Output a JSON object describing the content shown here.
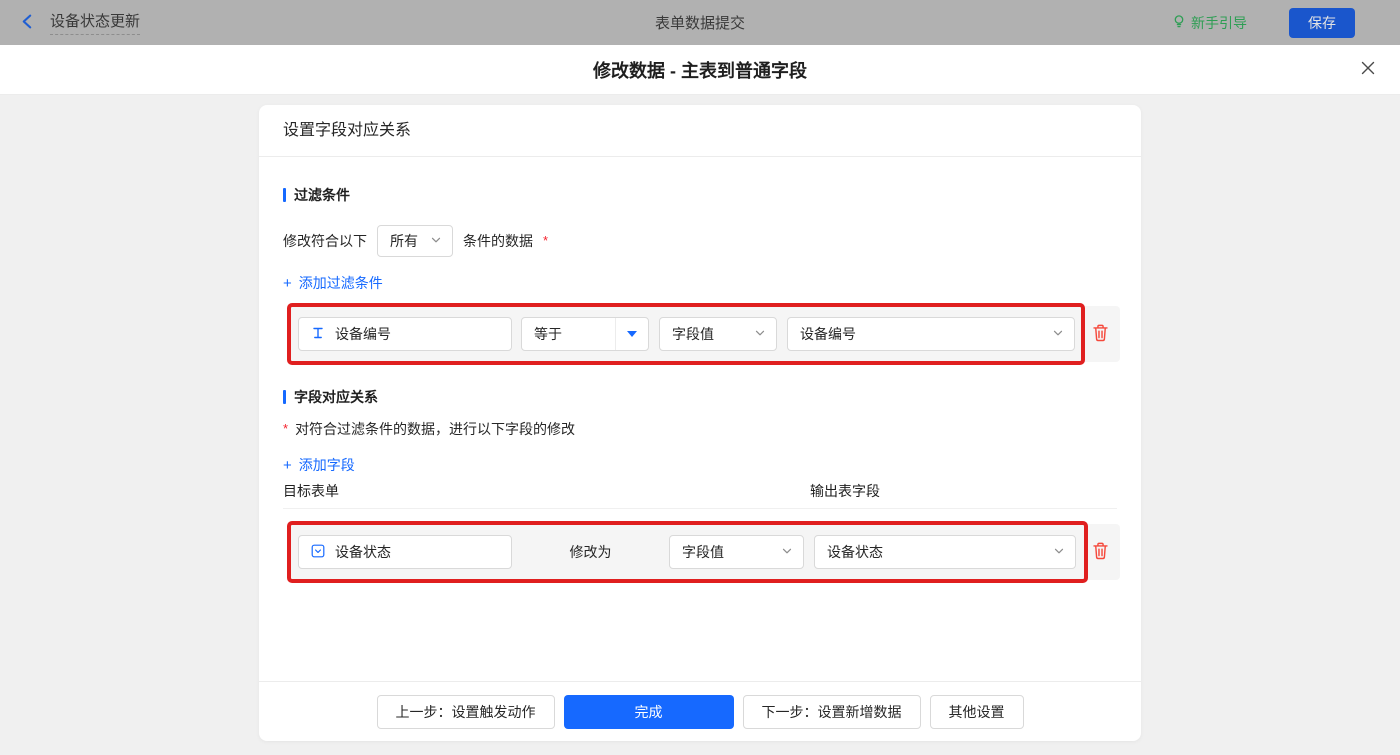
{
  "topbar": {
    "back_label": "设备状态更新",
    "center_title": "表单数据提交",
    "guide_label": "新手引导",
    "save_label": "保存"
  },
  "dialog": {
    "title": "修改数据 - 主表到普通字段"
  },
  "card": {
    "header": "设置字段对应关系",
    "filter_section": {
      "title": "过滤条件",
      "condition_prefix": "修改符合以下",
      "condition_select_value": "所有",
      "condition_suffix": "条件的数据",
      "required_mark": "*",
      "add_plus": "+",
      "add_label": "添加过滤条件",
      "row": {
        "field_name": "设备编号",
        "operator": "等于",
        "value_type": "字段值",
        "value_field": "设备编号"
      }
    },
    "mapping_section": {
      "title": "字段对应关系",
      "required_mark": "*",
      "description": "对符合过滤条件的数据，进行以下字段的修改",
      "add_plus": "+",
      "add_label": "添加字段",
      "col_target": "目标表单",
      "col_output": "输出表字段",
      "row": {
        "field_name": "设备状态",
        "action_label": "修改为",
        "value_type": "字段值",
        "value_field": "设备状态"
      }
    },
    "footer": {
      "prev_label": "上一步：设置触发动作",
      "done_label": "完成",
      "next_label": "下一步：设置新增数据",
      "other_label": "其他设置"
    }
  },
  "icons": {
    "back": "chevron-left",
    "guide": "lightbulb",
    "close": "x",
    "filter_field_type": "text-input",
    "mapping_field_type": "select-input",
    "operator_caret": "caret-down-filled",
    "dropdown": "chevron-down",
    "delete": "trash",
    "add": "plus"
  },
  "colors": {
    "accent_blue": "#1669ff",
    "annotation_red": "#e01f1f",
    "danger_red": "#f5483b",
    "guide_green": "#2e9e54",
    "topbar_bg": "#b1b1b1",
    "save_button_blue": "#1a56cc",
    "row_strip_bg": "#f5f5f5"
  }
}
